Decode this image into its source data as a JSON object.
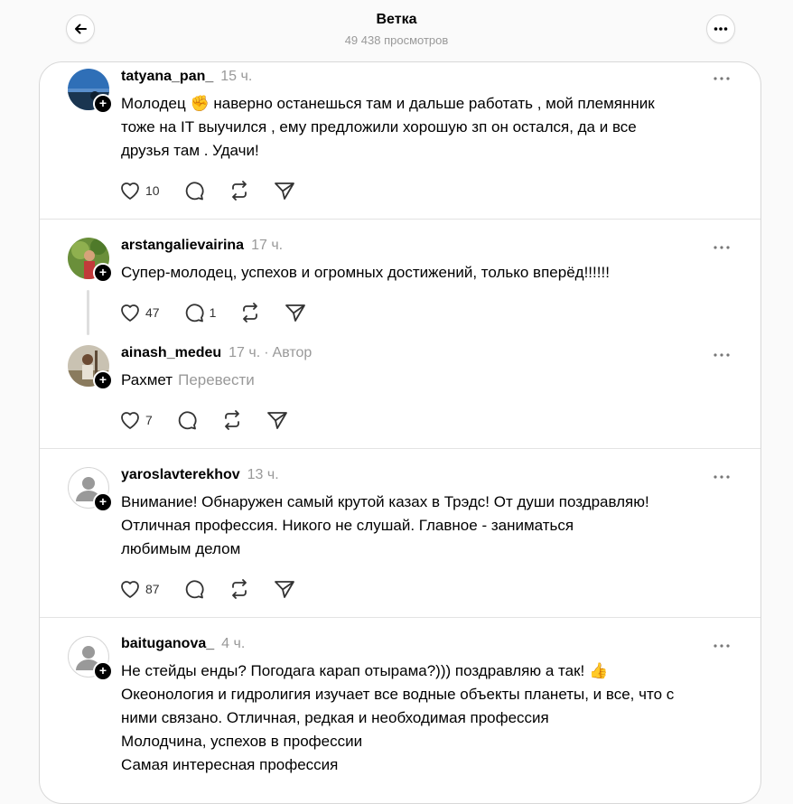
{
  "header": {
    "title": "Ветка",
    "views": "49 438 просмотров"
  },
  "posts": [
    {
      "username": "tatyana_pan_",
      "time": "15 ч.",
      "lines": [
        "Молодец ✊ наверно останешься там и дальше работать , мой племянник",
        "тоже на IT выучился , ему предложили хорошую зп он остался, да и все",
        "друзья там . Удачи!"
      ],
      "likes": "10",
      "replies": ""
    },
    {
      "username": "arstangalievairina",
      "time": "17 ч.",
      "lines": [
        "Супер-молодец, успехов и огромных достижений, только вперёд!!!!!!"
      ],
      "likes": "47",
      "replies": "1"
    },
    {
      "username": "ainash_medeu",
      "time": "17 ч.",
      "author_tag": "Автор",
      "text": "Рахмет",
      "translate": "Перевести",
      "likes": "7",
      "replies": ""
    },
    {
      "username": "yaroslavterekhov",
      "time": "13 ч.",
      "lines": [
        "Внимание! Обнаружен самый крутой казах в Трэдс! От души поздравляю!",
        "Отличная профессия. Никого не слушай. Главное - заниматься",
        "любимым делом"
      ],
      "likes": "87",
      "replies": ""
    },
    {
      "username": "baituganova_",
      "time": "4 ч.",
      "lines": [
        "Не стейды енды? Погодага карап отырама?))) поздравляю а так! 👍",
        "Океонология и гидролигия изучает все водные объекты планеты, и все, что с",
        "ними связано. Отличная, редкая и необходимая профессия",
        "Молодчина, успехов в профессии",
        "Самая интересная профессия"
      ],
      "likes": "",
      "replies": ""
    }
  ]
}
